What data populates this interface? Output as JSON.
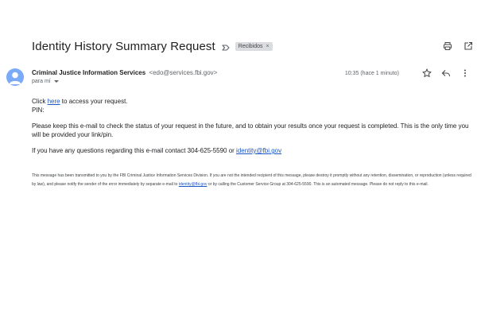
{
  "subject": "Identity History Summary Request",
  "label_chip": {
    "text": "Recibidos",
    "close": "×"
  },
  "sender": {
    "name": "Criminal Justice Information Services",
    "email": "<edo@services.fbi.gov>",
    "recipient": "para mí"
  },
  "time": "10:35 (hace 1 minuto)",
  "body": {
    "line1_prefix": "Click ",
    "line1_link": "here",
    "line1_suffix": " to access your request.",
    "pin": "PIN:",
    "paragraph2": "Please keep this e-mail to check the status of your request in the future, and to obtain your results once your request is completed. This is the only time you will be provided your link/pin.",
    "contact_prefix": "If you have any questions regarding this e-mail contact 304-625-5590 or ",
    "contact_link": "identity@fbi.gov"
  },
  "footer": {
    "part1": "This message has been transmitted to you by the FBI Criminal Justice Information Services Division. If you are not the intended recipient of this message, please destroy it promptly without any retention, dissemination, or reproduction (unless required by law), and please notify the sender of the error immediately by separate e-mail to ",
    "link": "identity@fbi.gov",
    "part2": " or by calling the Customer Service Group at 304-625-5590. This is an automated message. Please do not reply to this e-mail."
  },
  "colors": {
    "link": "#1a57c7",
    "avatar": "#7baaf7",
    "chip_bg": "#dadce0"
  },
  "icons": [
    "label-arrow-icon",
    "print-icon",
    "open-new-window-icon",
    "star-icon",
    "reply-icon",
    "more-vert-icon",
    "avatar-person-icon"
  ]
}
